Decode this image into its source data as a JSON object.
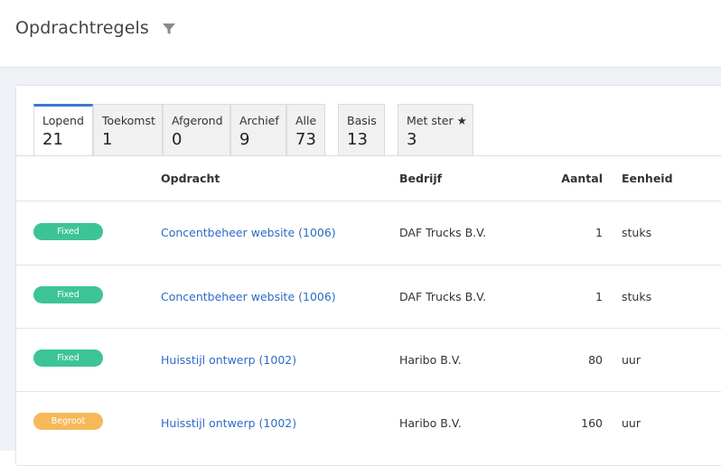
{
  "header": {
    "title": "Opdrachtregels",
    "filter_icon": "filter-icon"
  },
  "tabs": [
    {
      "label": "Lopend",
      "count": "21",
      "active": true
    },
    {
      "label": "Toekomst",
      "count": "1"
    },
    {
      "label": "Afgerond",
      "count": "0"
    },
    {
      "label": "Archief",
      "count": "9"
    },
    {
      "label": "Alle",
      "count": "73"
    },
    {
      "label": "Basis",
      "count": "13"
    },
    {
      "label": "Met ster ★",
      "count": "3"
    }
  ],
  "table": {
    "columns": [
      "Opdracht",
      "Bedrijf",
      "Aantal",
      "Eenheid"
    ],
    "rows": [
      {
        "status": "Fixed",
        "opdracht": "Concentbeheer website (1006)",
        "bedrijf": "DAF Trucks B.V.",
        "aantal": "1",
        "eenheid": "stuks"
      },
      {
        "status": "Fixed",
        "opdracht": "Concentbeheer website (1006)",
        "bedrijf": "DAF Trucks B.V.",
        "aantal": "1",
        "eenheid": "stuks"
      },
      {
        "status": "Fixed",
        "opdracht": "Huisstijl ontwerp (1002)",
        "bedrijf": "Haribo B.V.",
        "aantal": "80",
        "eenheid": "uur"
      },
      {
        "status": "Begroot",
        "opdracht": "Huisstijl ontwerp (1002)",
        "bedrijf": "Haribo B.V.",
        "aantal": "160",
        "eenheid": "uur"
      }
    ]
  },
  "colors": {
    "fixed": "#3cc497",
    "begroot": "#f5b95a",
    "link": "#2d6bc6",
    "active_tab": "#3a78d4"
  }
}
